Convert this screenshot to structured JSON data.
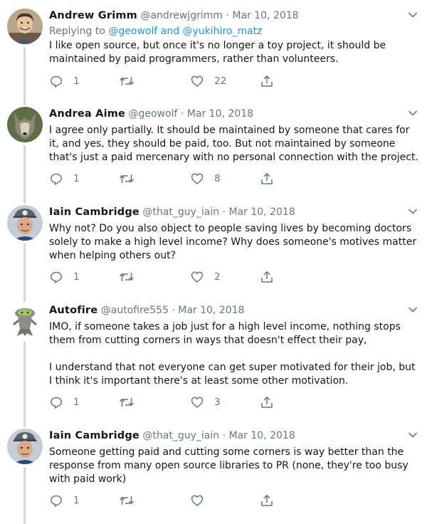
{
  "tweets": [
    {
      "name": "Andrew Grimm",
      "handle": "@andrewjgrimm",
      "dot": "·",
      "date": "Mar 10, 2018",
      "replying_prefix": "Replying to ",
      "replying_mentions": "@geowolf and @yukihiro_matz",
      "text": "I like open source, but once it's no longer a toy project, it should be maintained by paid programmers, rather than volunteers.",
      "replies": "1",
      "retweets": "",
      "likes": "22",
      "avatar": "avatar-photo-smiling-man"
    },
    {
      "name": "Andrea Aime",
      "handle": "@geowolf",
      "dot": "·",
      "date": "Mar 10, 2018",
      "text": "I agree only  partially. It should be maintained by someone that cares for it, and yes, they should be paid, too. But not maintained by someone that's just a paid mercenary with no personal connection with the project.",
      "replies": "1",
      "retweets": "",
      "likes": "8",
      "avatar": "avatar-wolf"
    },
    {
      "name": "Iain Cambridge",
      "handle": "@that_guy_iain",
      "dot": "·",
      "date": "Mar 10, 2018",
      "text": "Why not? Do you also object to people saving lives by becoming doctors solely to make a high level income? Why does someone's motives matter when helping others out?",
      "replies": "1",
      "retweets": "",
      "likes": "2",
      "avatar": "avatar-man-in-cap"
    },
    {
      "name": "Autofire",
      "handle": "@autofire555",
      "dot": "·",
      "date": "Mar 10, 2018",
      "text": "IMO, if someone takes a job just for a high level income, nothing stops them from cutting corners in ways that doesn't effect their pay,\n\nI understand that not everyone can get super motivated for their job, but I think it's important there's at least some other motivation.",
      "replies": "1",
      "retweets": "",
      "likes": "3",
      "avatar": "avatar-green-creature"
    },
    {
      "name": "Iain Cambridge",
      "handle": "@that_guy_iain",
      "dot": "·",
      "date": "Mar 10, 2018",
      "text": "Someone getting paid and cutting some corners is way better than the response from many open source libraries to PR (none, they're too busy with paid work)",
      "replies": "1",
      "retweets": "",
      "likes": "",
      "avatar": "avatar-man-in-cap"
    }
  ],
  "icons": [
    "reply-icon",
    "retweet-icon",
    "like-icon",
    "share-icon",
    "caret-down-icon"
  ],
  "colors": {
    "text": "#14171a",
    "muted": "#657786",
    "link": "#1b95e0",
    "thread_line": "#cfd9de",
    "icon": "#657786"
  }
}
